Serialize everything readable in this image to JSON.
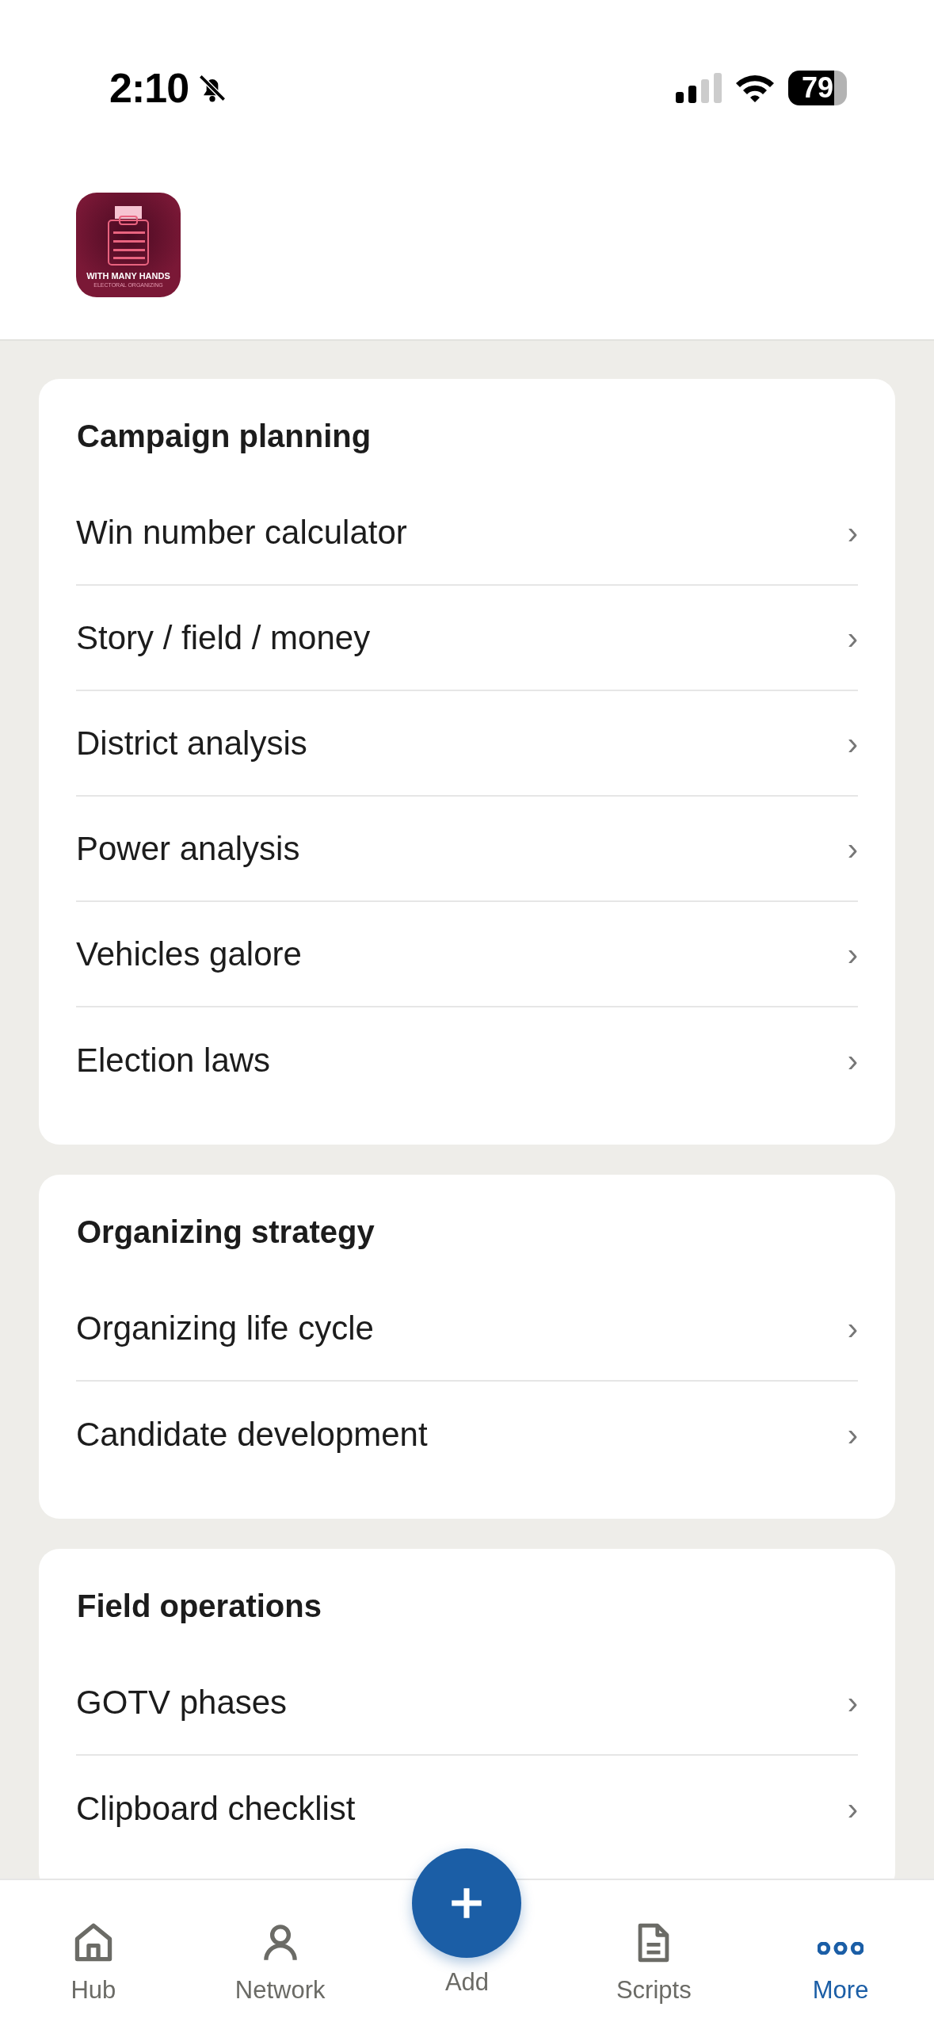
{
  "status_bar": {
    "time": "2:10",
    "silent": true,
    "battery": "79"
  },
  "logo": {
    "title": "WITH MANY HANDS",
    "subtitle": "ELECTORAL ORGANIZING"
  },
  "sections": [
    {
      "title": "Campaign planning",
      "items": [
        "Win number calculator",
        "Story / field / money",
        "District analysis",
        "Power analysis",
        "Vehicles galore",
        "Election laws"
      ]
    },
    {
      "title": "Organizing strategy",
      "items": [
        "Organizing life cycle",
        "Candidate development"
      ]
    },
    {
      "title": "Field operations",
      "items": [
        "GOTV phases",
        "Clipboard checklist"
      ]
    }
  ],
  "chevron": "›",
  "tab_bar": [
    {
      "label": "Hub",
      "selected": false
    },
    {
      "label": "Network",
      "selected": false
    },
    {
      "label": "Add",
      "selected": false
    },
    {
      "label": "Scripts",
      "selected": false
    },
    {
      "label": "More",
      "selected": true
    }
  ]
}
